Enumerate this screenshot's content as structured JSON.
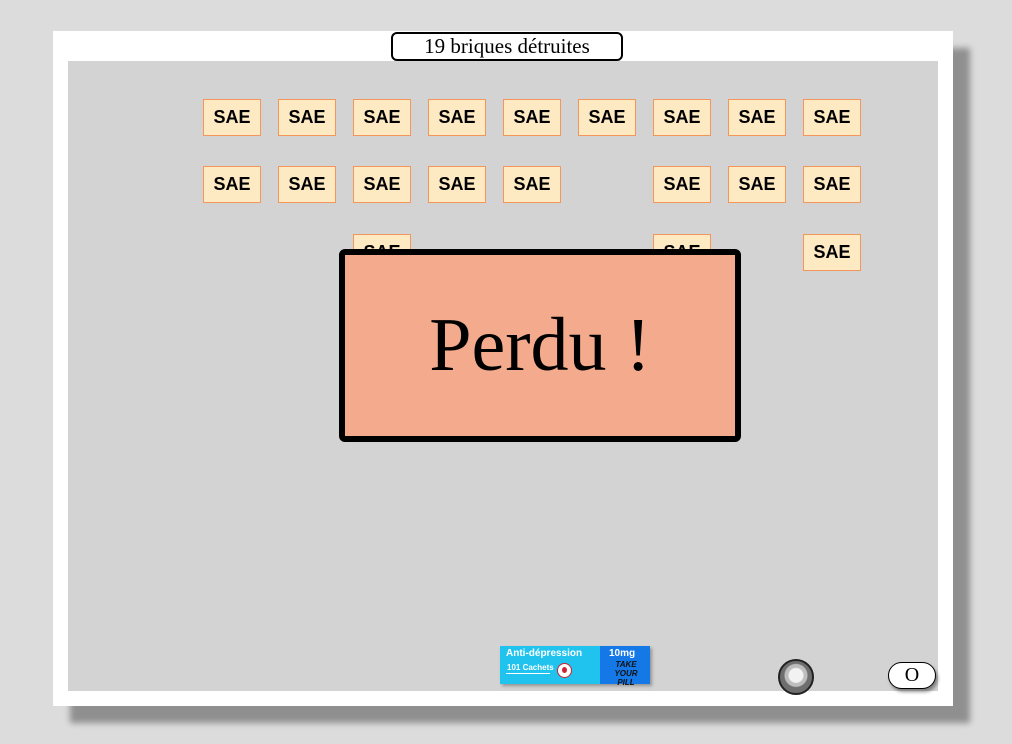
{
  "score": {
    "label": "19 briques détruites"
  },
  "bricks": {
    "label": "SAE",
    "row1": [
      "SAE",
      "SAE",
      "SAE",
      "SAE",
      "SAE",
      "SAE",
      "SAE",
      "SAE",
      "SAE"
    ],
    "row2": [
      "SAE",
      "SAE",
      "SAE",
      "SAE",
      "SAE",
      "SAE",
      "SAE",
      "SAE"
    ],
    "row3": [
      "SAE",
      "SAE",
      "SAE"
    ]
  },
  "game_over": {
    "message": "Perdu !"
  },
  "paddle": {
    "title": "Anti-dépression",
    "count": "101 Cachets",
    "dose": "10mg",
    "slogan": "TAKE YOUR PILL"
  },
  "ball": {
    "icon": "ball-avatar-icon"
  },
  "restart_button": {
    "label": "O"
  },
  "colors": {
    "background": "#dcdcdc",
    "playfield": "#d3d3d3",
    "brick_fill": "#fde9c2",
    "brick_border": "#f2965c",
    "overlay": "#f4ab8d",
    "paddle": "#1fc3ee",
    "paddle_accent": "#1478e6"
  }
}
